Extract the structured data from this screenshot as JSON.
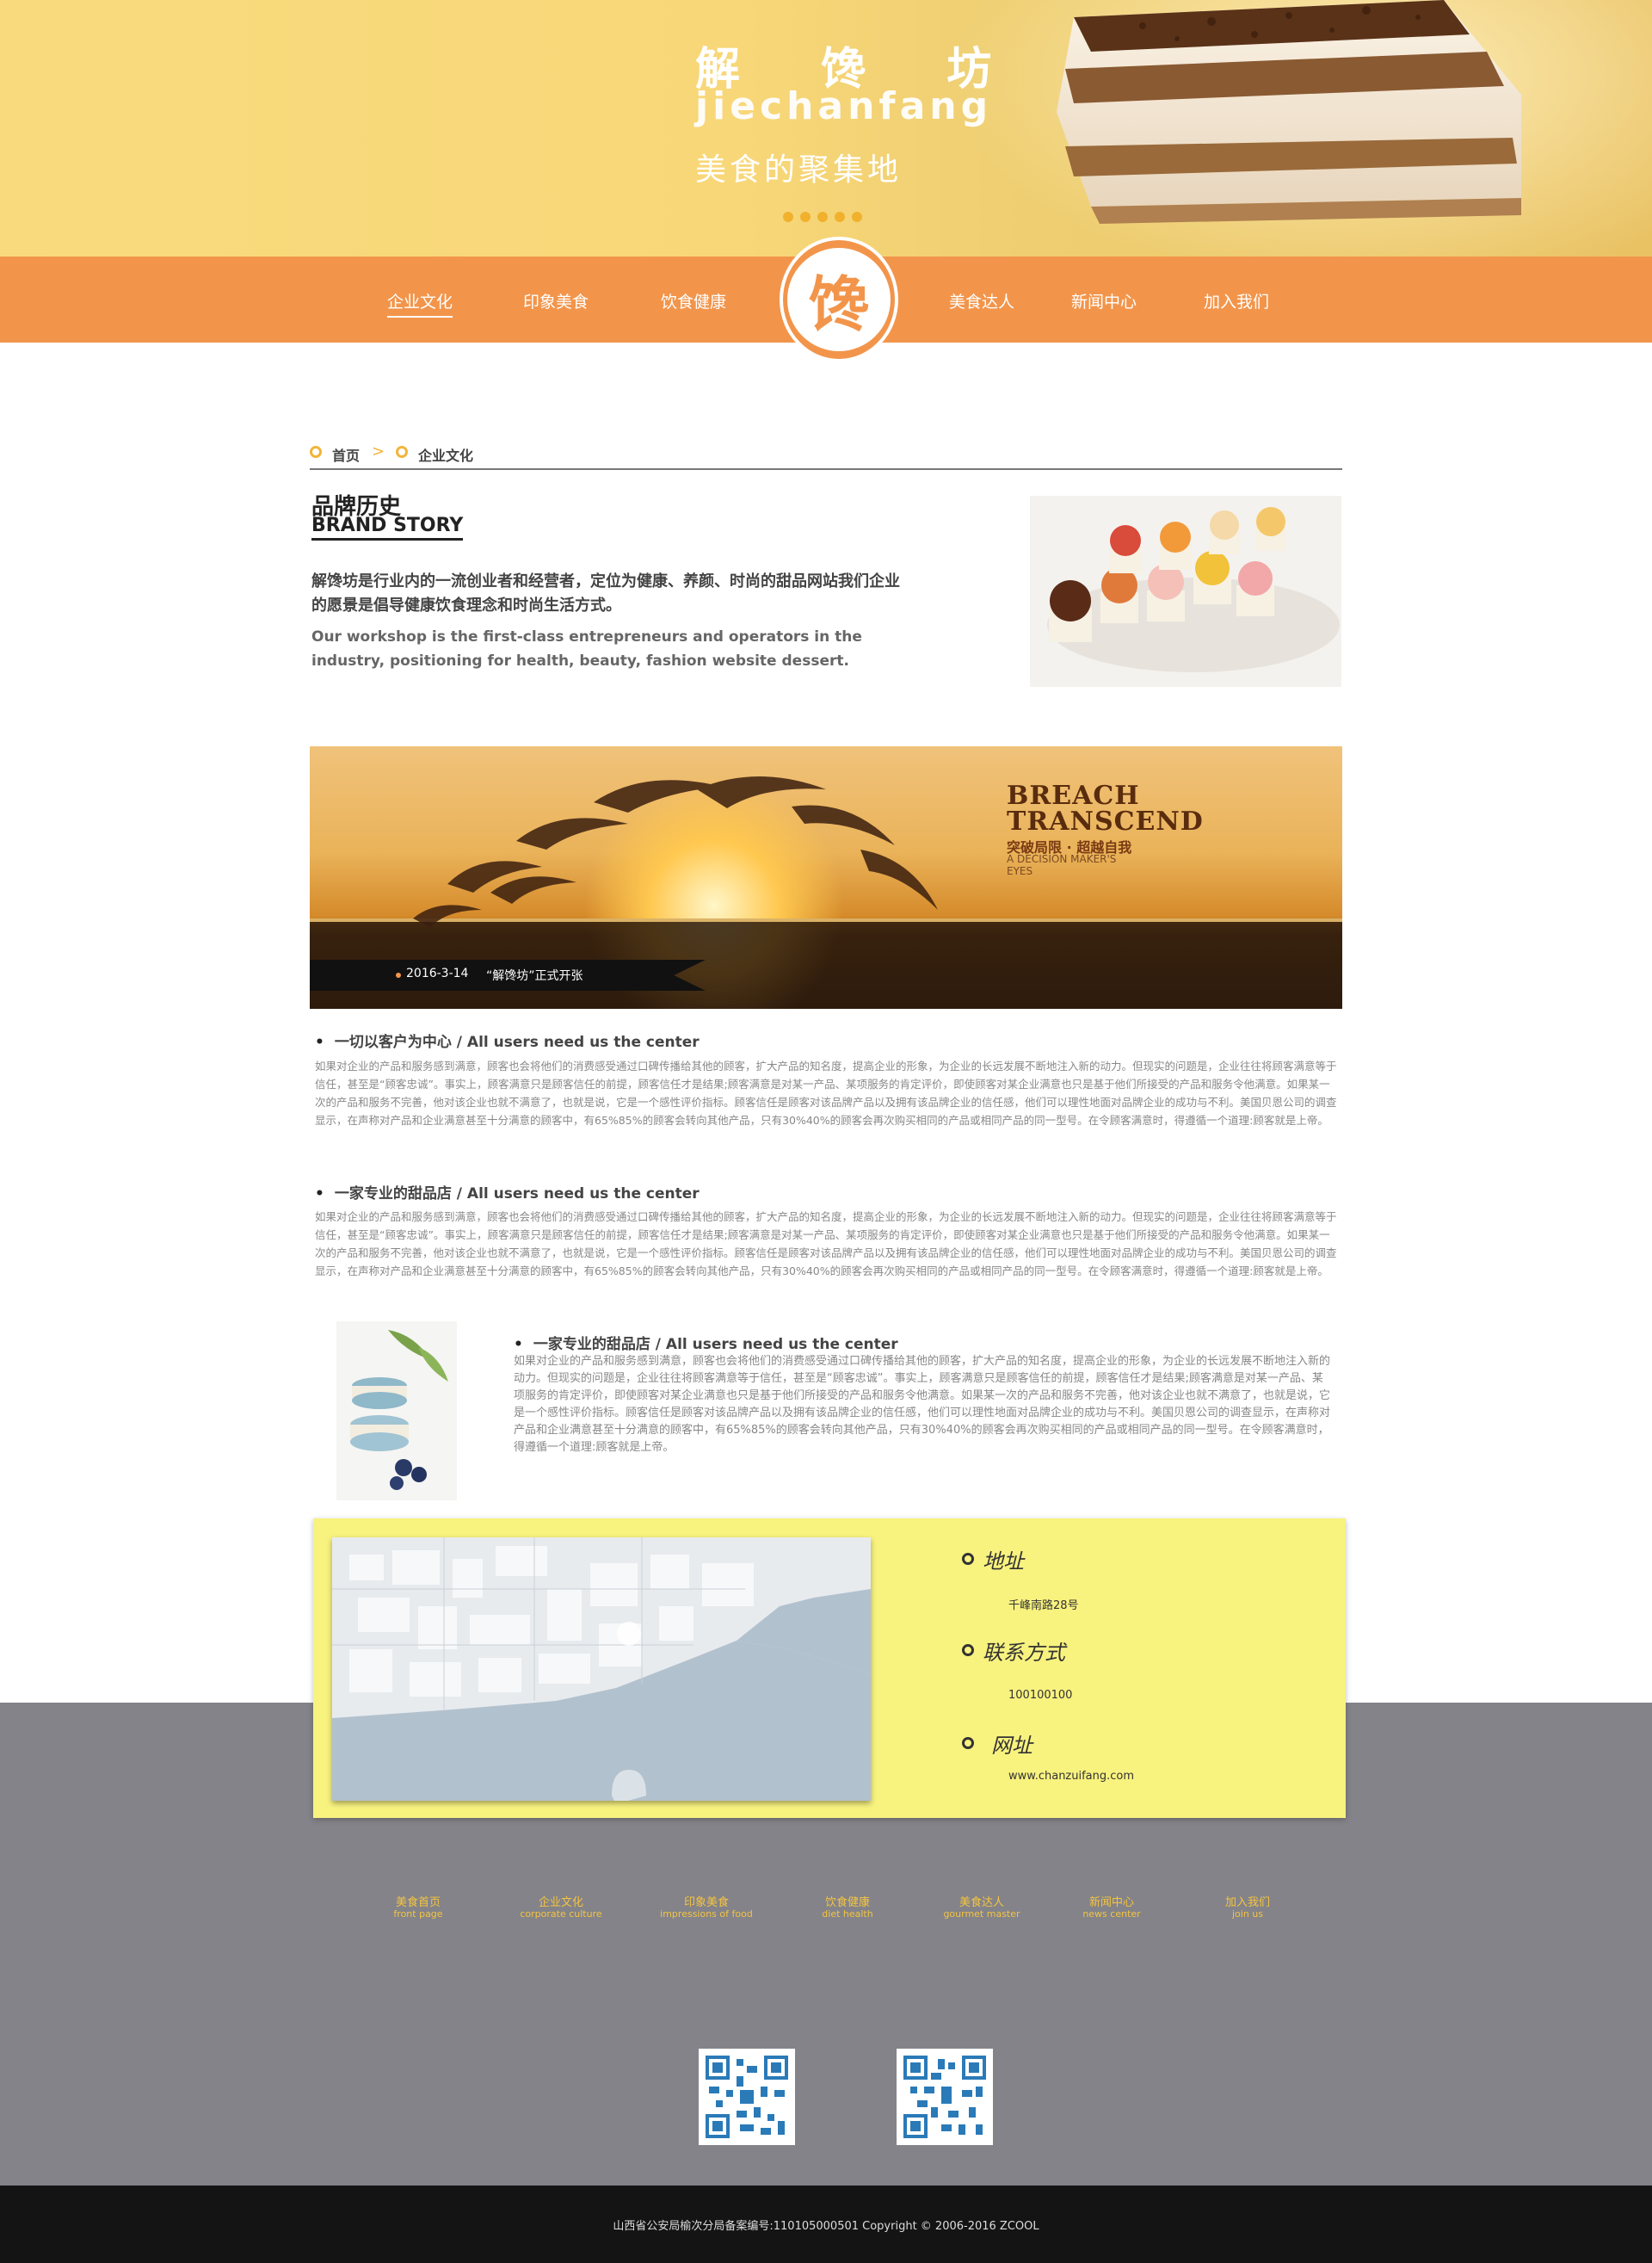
{
  "hero": {
    "title": "解 馋 坊",
    "subtitle": "jiechanfang",
    "slogan": "美食的聚集地"
  },
  "nav": {
    "items": [
      {
        "label": "企业文化",
        "active": true
      },
      {
        "label": "印象美食"
      },
      {
        "label": "饮食健康"
      },
      {
        "label": "美食达人"
      },
      {
        "label": "新闻中心"
      },
      {
        "label": "加入我们"
      }
    ],
    "logo_glyph": "馋"
  },
  "breadcrumb": {
    "home": "首页",
    "current": "企业文化",
    "separator": ">"
  },
  "brand": {
    "title_cn": "品牌历史",
    "title_en": "BRAND STORY",
    "text_cn": "解馋坊是行业内的一流创业者和经营者，定位为健康、养颜、时尚的甜品网站我们企业的愿景是倡导健康饮食理念和时尚生活方式。",
    "text_en": "Our workshop is the first-class entrepreneurs and operators in the industry, positioning for health, beauty, fashion website dessert."
  },
  "banner": {
    "date": "2016-3-14",
    "news": "“解馋坊”正式开张",
    "headline1": "BREACH",
    "headline2": "TRANSCEND",
    "headline_cn": "突破局限 · 超越自我",
    "tagline": "A DECISION MAKER'S EYES"
  },
  "sections": [
    {
      "title": "一切以客户为中心 / All users need us the center",
      "body": "如果对企业的产品和服务感到满意，顾客也会将他们的消费感受通过口碑传播给其他的顾客，扩大产品的知名度，提高企业的形象，为企业的长远发展不断地注入新的动力。但现实的问题是，企业往往将顾客满意等于信任，甚至是“顾客忠诚”。事实上，顾客满意只是顾客信任的前提，顾客信任才是结果;顾客满意是对某一产品、某项服务的肯定评价，即使顾客对某企业满意也只是基于他们所接受的产品和服务令他满意。如果某一次的产品和服务不完善，他对该企业也就不满意了，也就是说，它是一个感性评价指标。顾客信任是顾客对该品牌产品以及拥有该品牌企业的信任感，他们可以理性地面对品牌企业的成功与不利。美国贝恩公司的调查显示，在声称对产品和企业满意甚至十分满意的顾客中，有65%85%的顾客会转向其他产品，只有30%40%的顾客会再次购买相同的产品或相同产品的同一型号。在令顾客满意时，得遵循一个道理:顾客就是上帝。"
    },
    {
      "title": "一家专业的甜品店 / All users need us the center",
      "body": "如果对企业的产品和服务感到满意，顾客也会将他们的消费感受通过口碑传播给其他的顾客，扩大产品的知名度，提高企业的形象，为企业的长远发展不断地注入新的动力。但现实的问题是，企业往往将顾客满意等于信任，甚至是“顾客忠诚”。事实上，顾客满意只是顾客信任的前提，顾客信任才是结果;顾客满意是对某一产品、某项服务的肯定评价，即使顾客对某企业满意也只是基于他们所接受的产品和服务令他满意。如果某一次的产品和服务不完善，他对该企业也就不满意了，也就是说，它是一个感性评价指标。顾客信任是顾客对该品牌产品以及拥有该品牌企业的信任感，他们可以理性地面对品牌企业的成功与不利。美国贝恩公司的调查显示，在声称对产品和企业满意甚至十分满意的顾客中，有65%85%的顾客会转向其他产品，只有30%40%的顾客会再次购买相同的产品或相同产品的同一型号。在令顾客满意时，得遵循一个道理:顾客就是上帝。"
    },
    {
      "title": "一家专业的甜品店 / All users need us the center",
      "body": "如果对企业的产品和服务感到满意，顾客也会将他们的消费感受通过口碑传播给其他的顾客，扩大产品的知名度，提高企业的形象，为企业的长远发展不断地注入新的动力。但现实的问题是，企业往往将顾客满意等于信任，甚至是“顾客忠诚”。事实上，顾客满意只是顾客信任的前提，顾客信任才是结果;顾客满意是对某一产品、某项服务的肯定评价，即使顾客对某企业满意也只是基于他们所接受的产品和服务令他满意。如果某一次的产品和服务不完善，他对该企业也就不满意了，也就是说，它是一个感性评价指标。顾客信任是顾客对该品牌产品以及拥有该品牌企业的信任感，他们可以理性地面对品牌企业的成功与不利。美国贝恩公司的调查显示，在声称对产品和企业满意甚至十分满意的顾客中，有65%85%的顾客会转向其他产品，只有30%40%的顾客会再次购买相同的产品或相同产品的同一型号。在令顾客满意时，得遵循一个道理:顾客就是上帝。"
    }
  ],
  "contact": {
    "address_label": "地址",
    "address": "千峰南路28号",
    "phone_label": "联系方式",
    "phone": "100100100",
    "website_label": "网址",
    "website": "www.chanzuifang.com"
  },
  "footer": {
    "links": [
      {
        "cn": "美食首页",
        "en": "front page"
      },
      {
        "cn": "企业文化",
        "en": "corporate culture"
      },
      {
        "cn": "印象美食",
        "en": "impressions of food"
      },
      {
        "cn": "饮食健康",
        "en": "diet health"
      },
      {
        "cn": "美食达人",
        "en": "gourmet master"
      },
      {
        "cn": "新闻中心",
        "en": "news center"
      },
      {
        "cn": "加入我们",
        "en": "join us"
      }
    ],
    "copyright": "山西省公安局榆次分局备案编号:110105000501    Copyright © 2006-2016 ZCOOL"
  },
  "colors": {
    "hero_bg": "#f8d778",
    "nav_bg": "#f2954b",
    "contact_bg": "#f8f27f",
    "footer_bg": "#838389",
    "footer_link": "#f5c441",
    "bottom_bar": "#141414"
  },
  "icons": [
    "cake-image",
    "cupcakes-image",
    "dolphins-banner-image",
    "macaron-image",
    "map-image",
    "qr-code-icon"
  ]
}
